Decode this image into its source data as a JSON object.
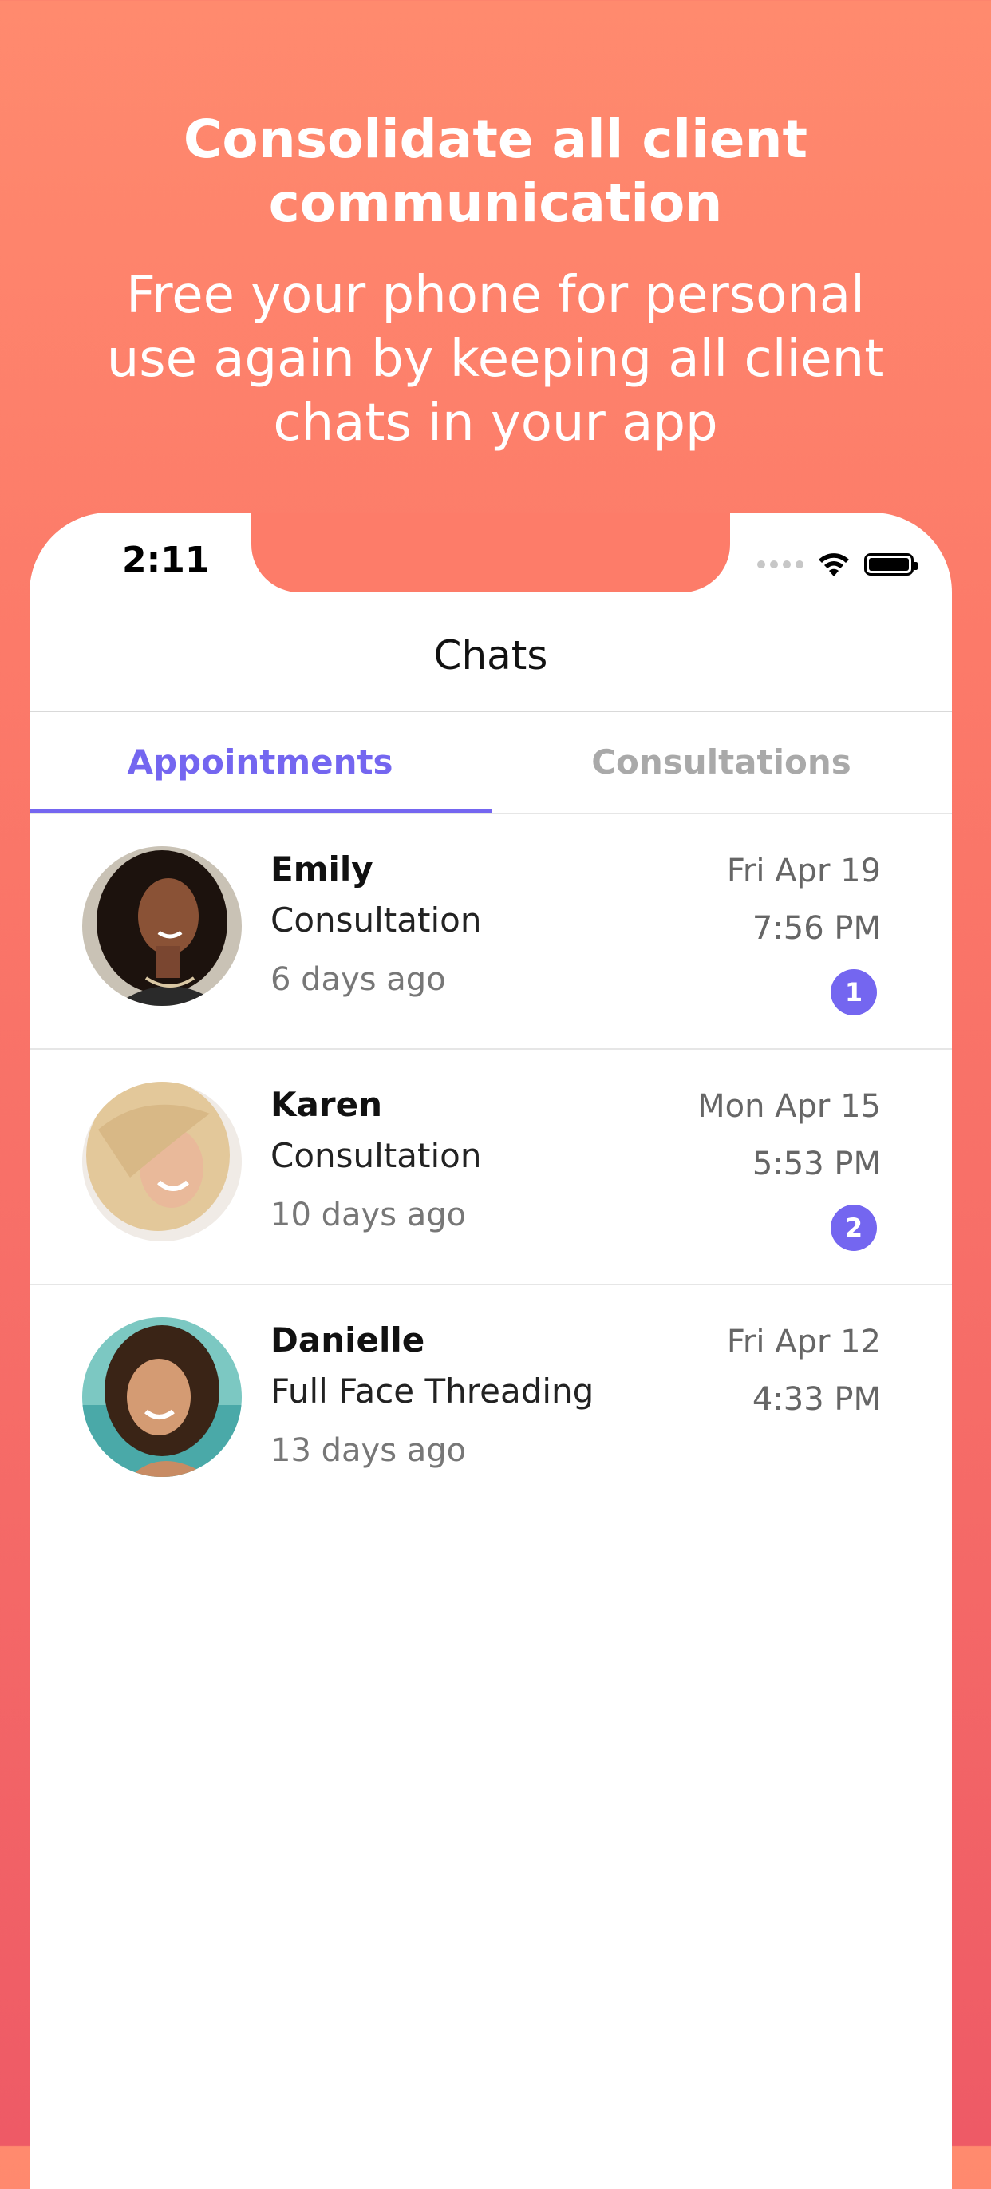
{
  "marketing": {
    "headline": "Consolidate all client communication",
    "subline": "Free your phone for personal use again by keeping all client chats in your app"
  },
  "status_bar": {
    "time": "2:11"
  },
  "nav": {
    "title": "Chats"
  },
  "tabs": [
    {
      "label": "Appointments",
      "active": true
    },
    {
      "label": "Consultations",
      "active": false
    }
  ],
  "chats": [
    {
      "name": "Emily",
      "service": "Consultation",
      "ago": "6 days ago",
      "date": "Fri Apr 19",
      "time": "7:56 PM",
      "unread": "1"
    },
    {
      "name": "Karen",
      "service": "Consultation",
      "ago": "10 days ago",
      "date": "Mon Apr 15",
      "time": "5:53 PM",
      "unread": "2"
    },
    {
      "name": "Danielle",
      "service": "Full Face Threading",
      "ago": "13 days ago",
      "date": "Fri Apr 12",
      "time": "4:33 PM",
      "unread": null
    }
  ],
  "colors": {
    "accent": "#7466f0",
    "background_top": "#ff8a6e",
    "background_bottom": "#ee5a66"
  }
}
